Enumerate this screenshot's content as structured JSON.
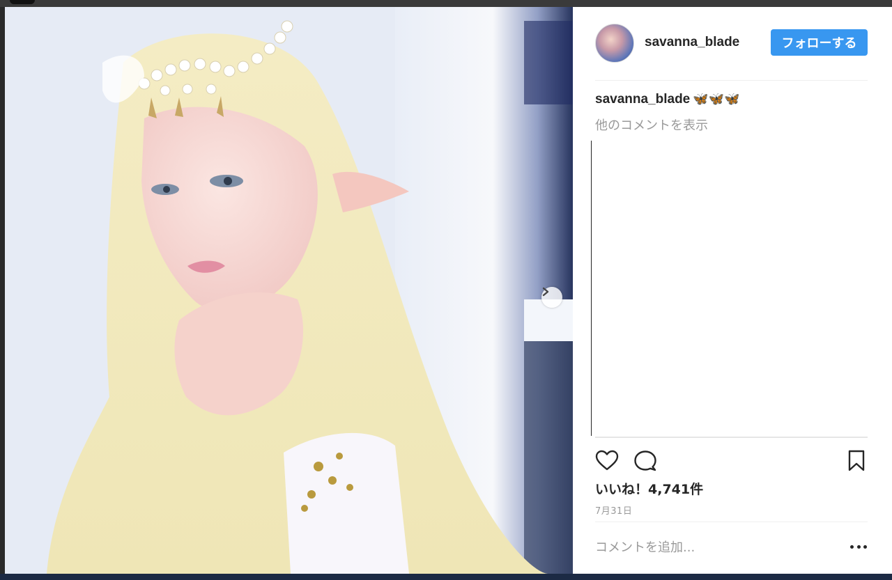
{
  "post": {
    "username": "savanna_blade",
    "follow_label": "フォローする",
    "caption_user": "savanna_blade",
    "caption_text": "🦋🦋🦋",
    "more_comments_label": "他のコメントを表示",
    "likes_text": "いいね！4,741件",
    "date_text": "7月31日",
    "add_comment_placeholder": "コメントを追加..."
  },
  "icons": {
    "like": "heart-icon",
    "comment": "comment-icon",
    "save": "bookmark-icon",
    "next": "chevron-right-icon",
    "more": "more-options-icon"
  },
  "colors": {
    "follow_button": "#3897f0",
    "username_text": "#262626",
    "muted_text": "#999999"
  }
}
